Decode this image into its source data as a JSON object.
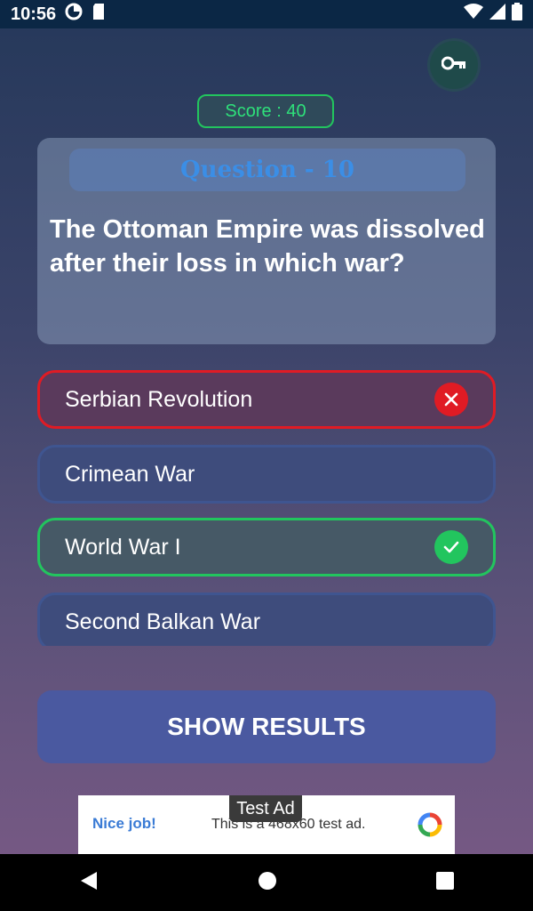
{
  "status_bar": {
    "time": "10:56",
    "icons": [
      "data-saver-icon",
      "sd-card-icon",
      "wifi-icon",
      "signal-icon",
      "battery-icon"
    ]
  },
  "header": {
    "key_icon": "key-icon",
    "score": "Score : 40"
  },
  "question": {
    "title": "Question - 10",
    "text": "The Ottoman Empire was dissolved after their loss in which war?"
  },
  "answers": [
    {
      "label": "Serbian Revolution",
      "state": "wrong"
    },
    {
      "label": "Crimean War",
      "state": "neutral"
    },
    {
      "label": "World War I",
      "state": "correct"
    },
    {
      "label": "Second Balkan War",
      "state": "neutral"
    }
  ],
  "actions": {
    "show_results": "SHOW RESULTS"
  },
  "ad": {
    "tag": "Test Ad",
    "nice": "Nice job!",
    "text": "This is a 468x60 test ad."
  },
  "nav": {
    "icons": [
      "back-icon",
      "home-icon",
      "recents-icon"
    ]
  },
  "colors": {
    "correct": "#22c55e",
    "wrong": "#e01b24",
    "accent": "#3b8ee6"
  }
}
